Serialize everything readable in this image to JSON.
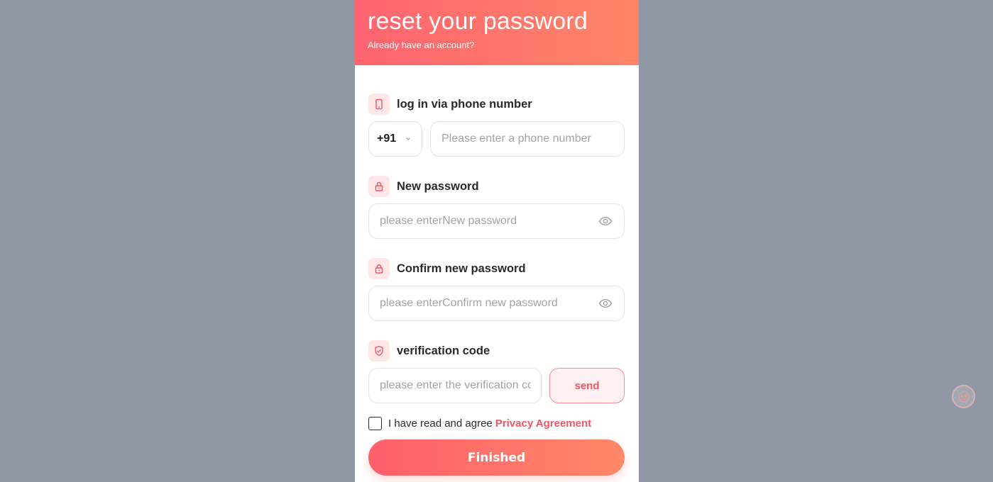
{
  "header": {
    "title": "reset your password",
    "subtitle": "Already have an account?"
  },
  "phone": {
    "label": "log in via phone number",
    "icon": "phone-icon",
    "country_code": "+91",
    "placeholder": "Please enter a phone number"
  },
  "new_password": {
    "label": "New password",
    "icon": "lock-icon",
    "placeholder": "please enterNew password"
  },
  "confirm_password": {
    "label": "Confirm new password",
    "icon": "lock-icon",
    "placeholder": "please enterConfirm new password"
  },
  "verification": {
    "label": "verification code",
    "icon": "shield-check-icon",
    "placeholder": "please enter the verification code",
    "send_label": "send"
  },
  "agreement": {
    "text": "I have read and agree",
    "link": "Privacy Agreement",
    "checked": false
  },
  "submit": {
    "label": "Finished"
  },
  "colors": {
    "accent": "#ef5566",
    "gradient_start": "#ff6470",
    "gradient_end": "#ff8566",
    "backdrop": "#9097a5"
  }
}
